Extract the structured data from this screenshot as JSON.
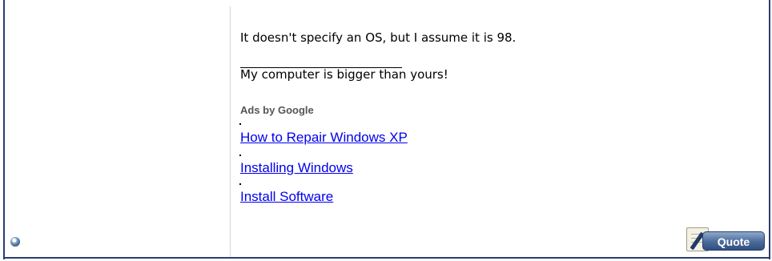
{
  "post": {
    "body_text": "It doesn't specify an OS, but I assume it is 98.",
    "signature": "My computer is bigger than yours!"
  },
  "ads": {
    "label": "Ads by Google",
    "links": [
      "How to Repair Windows XP",
      "Installing Windows",
      "Install Software"
    ]
  },
  "footer": {
    "quote_label": "Quote",
    "status_icon": "offline-status-icon"
  },
  "colors": {
    "border": "#2a3f6e",
    "link": "#0000ee",
    "ads_label": "#555555"
  }
}
